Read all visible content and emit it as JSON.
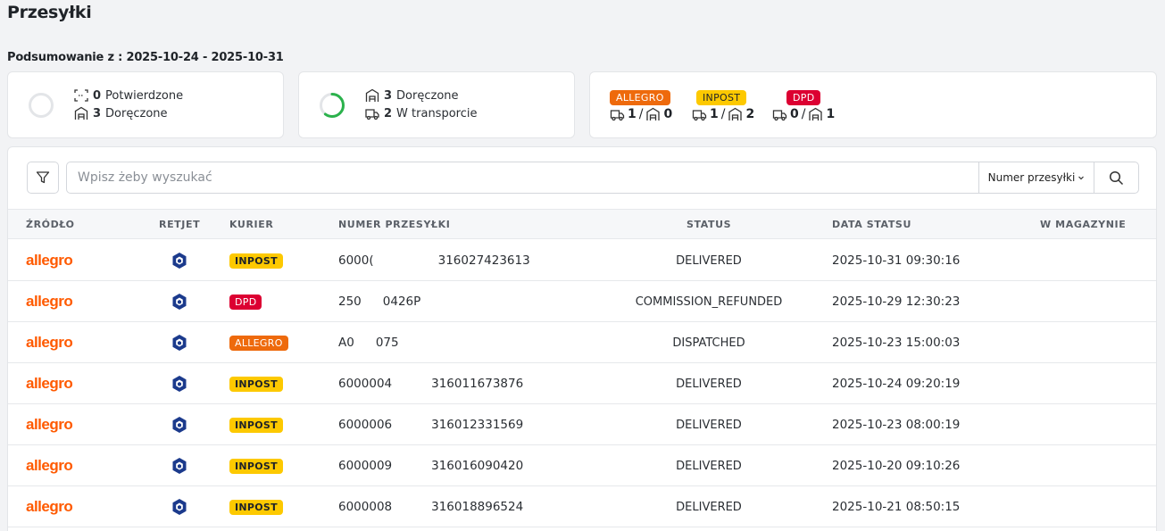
{
  "page": {
    "title": "Przesyłki"
  },
  "summary": {
    "label": "Podsumowanie z : 2025-10-24 - 2025-10-31",
    "card1": {
      "progress_fraction": 0,
      "items": [
        {
          "count": "0",
          "label": "Potwierdzone",
          "icon": "scan-icon"
        },
        {
          "count": "3",
          "label": "Doręczone",
          "icon": "warehouse-icon"
        }
      ]
    },
    "card2": {
      "progress_fraction": 0.6,
      "items": [
        {
          "count": "3",
          "label": "Doręczone",
          "icon": "warehouse-icon"
        },
        {
          "count": "2",
          "label": "W transporcie",
          "icon": "truck-icon"
        }
      ]
    },
    "couriers": [
      {
        "name": "ALLEGRO",
        "color": "#ee6a0c",
        "in_transport": "1",
        "delivered": "0"
      },
      {
        "name": "INPOST",
        "color": "#fdc900",
        "in_transport": "1",
        "delivered": "2"
      },
      {
        "name": "DPD",
        "color": "#dc0032",
        "in_transport": "0",
        "delivered": "1"
      }
    ]
  },
  "search": {
    "placeholder": "Wpisz żeby wyszukać",
    "field_select": "Numer przesyłki"
  },
  "table": {
    "headers": {
      "source": "ŹRÓDŁO",
      "retjet": "RETJET",
      "courier": "KURIER",
      "number": "NUMER PRZESYŁKI",
      "status": "STATUS",
      "status_date": "DATA STATSU",
      "warehouse": "W MAGAZYNIE"
    },
    "rows": [
      {
        "source": "allegro",
        "courier": "INPOST",
        "number_start": "6000(",
        "number_end": "316027423613",
        "status": "DELIVERED",
        "date": "2025-10-31 09:30:16"
      },
      {
        "source": "allegro",
        "courier": "DPD",
        "number_start": "250",
        "number_end": "0426P",
        "status": "COMMISSION_REFUNDED",
        "date": "2025-10-29 12:30:23"
      },
      {
        "source": "allegro",
        "courier": "ALLEGRO",
        "number_start": "A0",
        "number_end": "075",
        "status": "DISPATCHED",
        "date": "2025-10-23 15:00:03"
      },
      {
        "source": "allegro",
        "courier": "INPOST",
        "number_start": "6000004",
        "number_end": "316011673876",
        "status": "DELIVERED",
        "date": "2025-10-24 09:20:19"
      },
      {
        "source": "allegro",
        "courier": "INPOST",
        "number_start": "6000006",
        "number_end": "316012331569",
        "status": "DELIVERED",
        "date": "2025-10-23 08:00:19"
      },
      {
        "source": "allegro",
        "courier": "INPOST",
        "number_start": "6000009",
        "number_end": "316016090420",
        "status": "DELIVERED",
        "date": "2025-10-20 09:10:26"
      },
      {
        "source": "allegro",
        "courier": "INPOST",
        "number_start": "6000008",
        "number_end": "316018896524",
        "status": "DELIVERED",
        "date": "2025-10-21 08:50:15"
      }
    ]
  }
}
